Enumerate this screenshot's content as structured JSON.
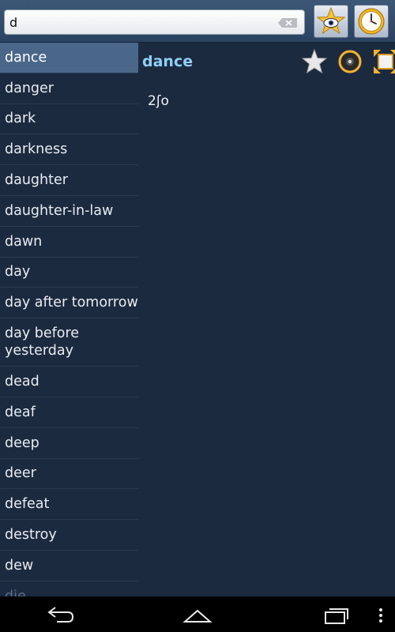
{
  "search": {
    "value": "d"
  },
  "words": [
    "dance",
    "danger",
    "dark",
    "darkness",
    "daughter",
    "daughter-in-law",
    "dawn",
    "day",
    "day after tomorrow",
    "day before yesterday",
    "dead",
    "deaf",
    "deep",
    "deer",
    "defeat",
    "destroy",
    "dew",
    "die"
  ],
  "selected_word": "dance",
  "detail": {
    "title": "dance",
    "definition": "2ʃo"
  },
  "icons": {
    "favorites": "star-eye-icon",
    "history": "clock-icon",
    "star": "star-icon",
    "audio": "speaker-icon",
    "expand": "fullscreen-icon",
    "back": "back-arrow-icon",
    "home": "home-icon",
    "recent": "recent-apps-icon",
    "menu": "overflow-menu-icon"
  }
}
